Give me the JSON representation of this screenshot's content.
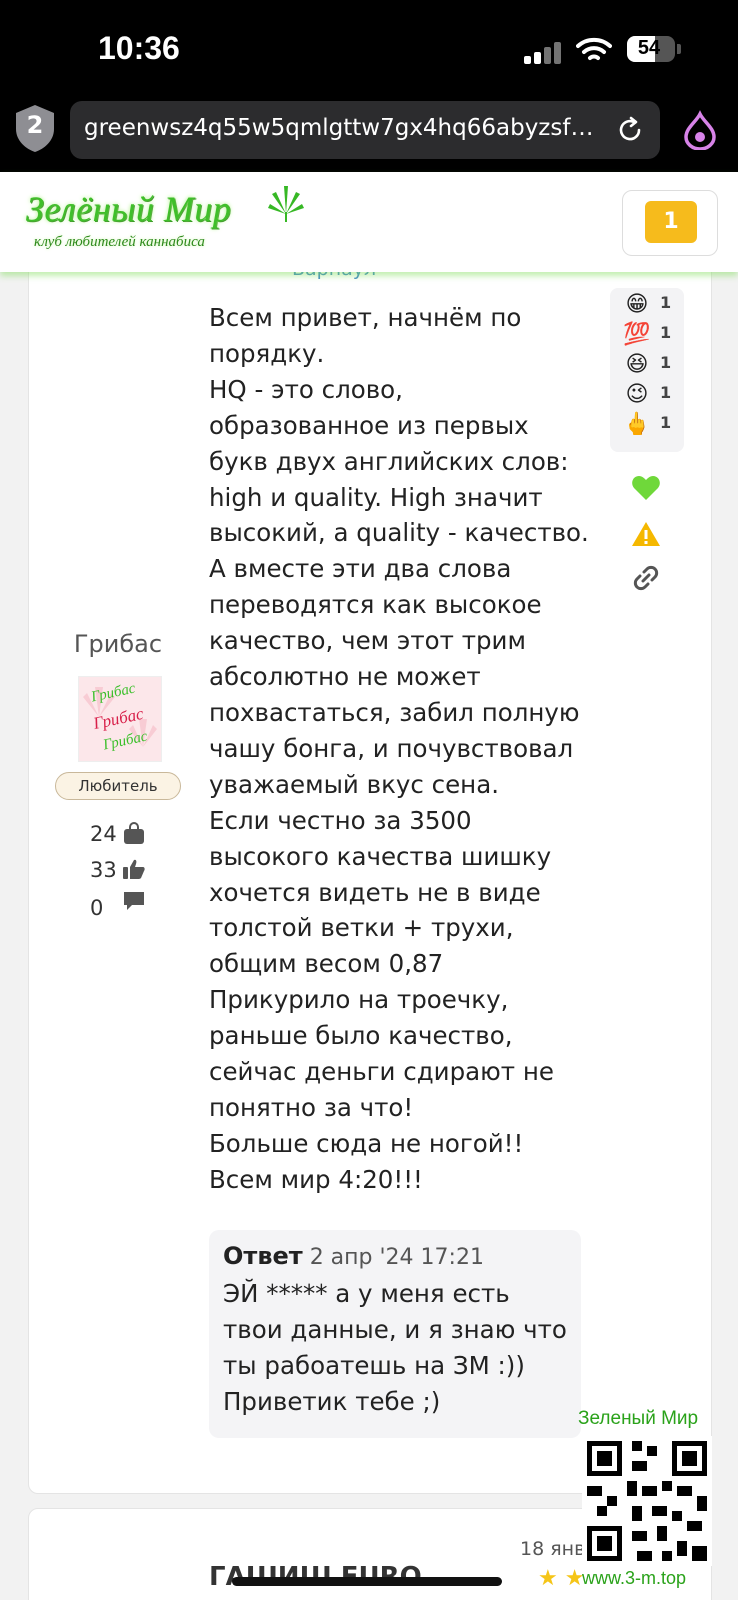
{
  "status_bar": {
    "time": "10:36",
    "battery": "54",
    "battery_level": 0.54
  },
  "browser": {
    "tab_count": "2",
    "url": "greenwsz4q55w5qmlgttw7gx4hq66abyzsfoeu...",
    "icons": [
      "shield-icon",
      "reload-icon",
      "onion-icon"
    ]
  },
  "site": {
    "logo_title": "Зелёный Мир",
    "logo_subtitle": "клуб любителей каннабиса",
    "notifications": "1"
  },
  "post": {
    "city": "Барнаул",
    "author": {
      "name": "Грибас",
      "avatar_text": [
        "Грибас",
        "Грибас",
        "Грибас"
      ],
      "rank": "Любитель",
      "stats": [
        {
          "value": "24",
          "icon": "bag-icon"
        },
        {
          "value": "33",
          "icon": "thumbs-up-icon"
        },
        {
          "value": "0",
          "icon": "comment-icon"
        }
      ]
    },
    "body": [
      "Всем привет, начнём по порядку.",
      "HQ - это слово, образованное из первых букв двух английских слов: high и quality. High значит высокий, а quality - качество. А вместе эти два слова переводятся как высокое качество, чем этот трим абсолютно не может похвастаться, забил полную чашу бонга, и почувствовал уважаемый вкус сена.",
      "Если честно за 3500 высокого качества шишку хочется видеть не в виде толстой ветки + трухи, общим весом 0,87",
      "Прикурило на троечку, раньше было качество, сейчас деньги сдирают не понятно за что!",
      "Больше сюда не ногой!!",
      "Всем мир 4:20!!!"
    ],
    "reactions": [
      {
        "emoji": "😁",
        "count": "1"
      },
      {
        "emoji": "💯",
        "count": "1"
      },
      {
        "emoji": "😆",
        "count": "1"
      },
      {
        "emoji": "😉",
        "count": "1"
      },
      {
        "emoji": "🖕",
        "count": "1"
      }
    ],
    "actions": [
      "heart-icon",
      "warning-icon",
      "link-icon"
    ],
    "colors": {
      "heart": "#6fd83a",
      "warning": "#f5b800",
      "link": "#555555"
    },
    "reply": {
      "label": "Ответ",
      "date": "2 апр '24 17:21",
      "text": "ЭЙ ***** а у меня есть твои данные, и я знаю что ты рабоатешь на ЗМ :)) Приветик тебе ;)"
    }
  },
  "next_post": {
    "date": "18 янв",
    "title": "ГАШИШ EURO"
  },
  "watermark": {
    "title": "Зеленый Мир",
    "url": "www.3-m.top"
  }
}
